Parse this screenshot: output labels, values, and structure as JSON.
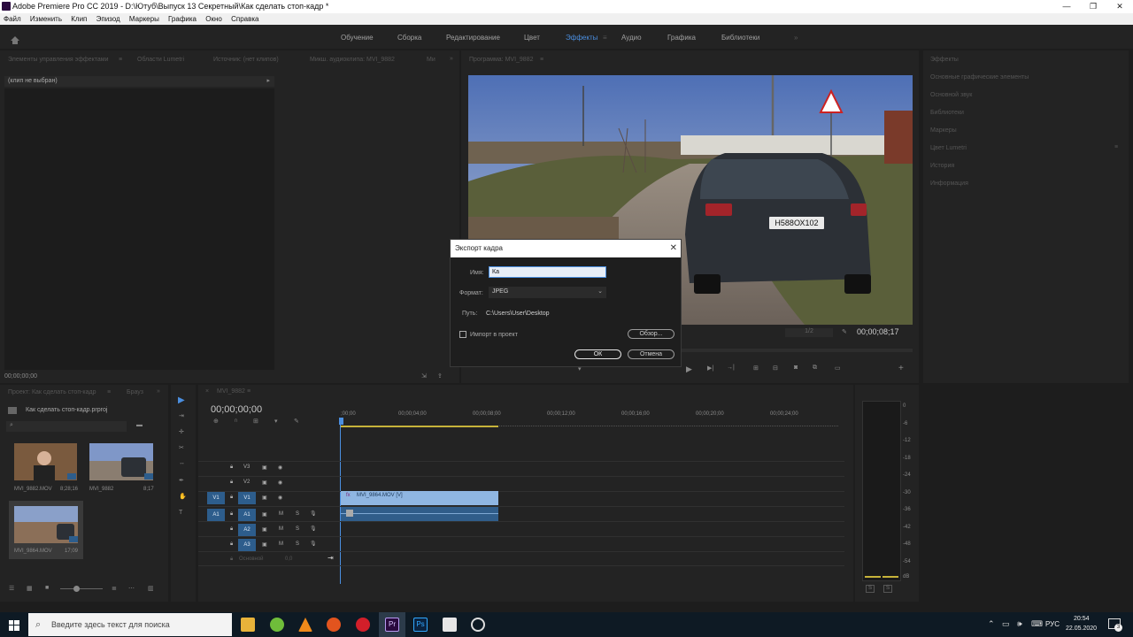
{
  "window": {
    "title": "Adobe Premiere Pro CC 2019 - D:\\Ютуб\\Выпуск 13 Секретный\\Как сделать стоп-кадр *"
  },
  "menu": [
    "Файл",
    "Изменить",
    "Клип",
    "Эпизод",
    "Маркеры",
    "Графика",
    "Окно",
    "Справка"
  ],
  "workspaces": [
    "Обучение",
    "Сборка",
    "Редактирование",
    "Цвет",
    "Эффекты",
    "Аудио",
    "Графика",
    "Библиотеки"
  ],
  "workspace_active": "Эффекты",
  "effect_controls": {
    "tabs": [
      "Элементы управления эффектами",
      "Области Lumetri",
      "Источник: (нет клипов)",
      "Микш. аудиоклипа: MVI_9882",
      "Ми"
    ],
    "no_clip": "(клип не выбран)",
    "timecode": "00;00;00;00"
  },
  "program": {
    "title": "Программа: MVI_9882",
    "timecode": "00;00;08;17",
    "fit": "1/2"
  },
  "right_panel": [
    "Эффекты",
    "Основные графические элементы",
    "Основной звук",
    "Библиотеки",
    "Маркеры",
    "Цвет Lumetri",
    "История",
    "Информация"
  ],
  "project": {
    "tabs": [
      "Проект: Как сделать стоп-кадр",
      "Брауз"
    ],
    "file": "Как сделать стоп-кадр.prproj",
    "items": [
      {
        "name": "MVI_9882.MOV",
        "duration": "8;28;16"
      },
      {
        "name": "MVI_9882",
        "duration": "8;17"
      },
      {
        "name": "MVI_9864.MOV",
        "duration": "17;09"
      }
    ]
  },
  "timeline": {
    "tab": "MVI_9882",
    "timecode": "00;00;00;00",
    "ruler": [
      ";00;00",
      "00;00;04;00",
      "00;00;08;00",
      "00;00;12;00",
      "00;00;16;00",
      "00;00;20;00",
      "00;00;24;00"
    ],
    "tracks_video": [
      "V3",
      "V2",
      "V1"
    ],
    "tracks_audio": [
      "A1",
      "A2",
      "A3"
    ],
    "target_v": "V1",
    "target_a": "A1",
    "master": "Основной",
    "master_val": "0,0",
    "clip_label": "MVI_9864.MOV [V]",
    "clip_fx": "fx"
  },
  "meter": {
    "labels": [
      "0",
      "-6",
      "-12",
      "-18",
      "-24",
      "-30",
      "-36",
      "-42",
      "-48",
      "-54",
      "dB"
    ],
    "solo": "S"
  },
  "dialog": {
    "title": "Экспорт кадра",
    "name_label": "Имя:",
    "name_value": "Ка",
    "format_label": "Формат:",
    "format_value": "JPEG",
    "path_label": "Путь:",
    "path_value": "C:\\Users\\User\\Desktop",
    "import_label": "Импорт в проект",
    "browse": "Обзор...",
    "ok": "ОК",
    "cancel": "Отмена"
  },
  "video_frame": {
    "plate": "Н588ОХ102"
  },
  "taskbar": {
    "search_placeholder": "Введите здесь текст для поиска",
    "lang": "РУС",
    "time": "20:54",
    "date": "22.05.2020",
    "notif": "3"
  }
}
